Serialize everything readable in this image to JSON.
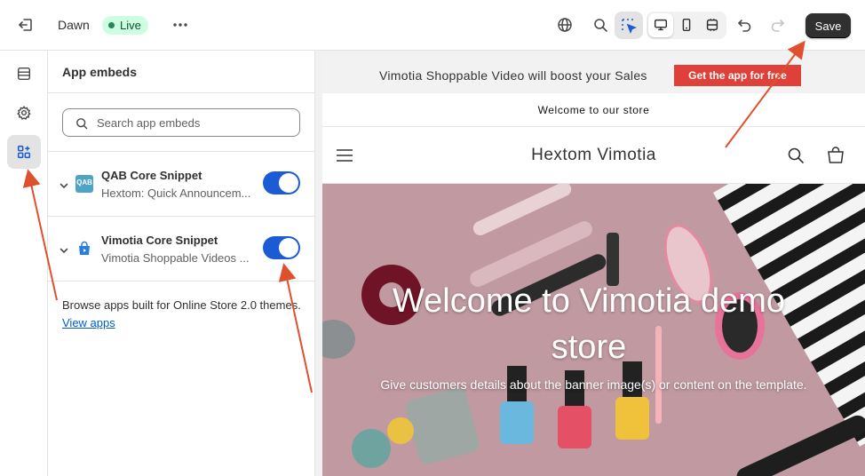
{
  "topbar": {
    "theme_name": "Dawn",
    "status_badge": "Live",
    "save_label": "Save"
  },
  "panel": {
    "title": "App embeds",
    "search_placeholder": "Search app embeds",
    "embeds": [
      {
        "name": "QAB Core Snippet",
        "description": "Hextom: Quick Announcem...",
        "logo_text": "QAB",
        "enabled": true
      },
      {
        "name": "Vimotia Core Snippet",
        "description": "Vimotia Shoppable Videos ...",
        "enabled": true
      }
    ],
    "browse_text": "Browse apps built for Online Store 2.0 themes.",
    "view_apps_link": "View apps"
  },
  "preview": {
    "promo_text": "Vimotia Shoppable Video will boost your Sales",
    "promo_button": "Get the app for free",
    "announcement": "Welcome to our store",
    "store_name": "Hextom Vimotia",
    "hero_title": "Welcome to Vimotia demo store",
    "hero_subtitle": "Give customers details about the banner image(s) or content on the template."
  },
  "colors": {
    "accent": "#1c5bd4",
    "live_badge_bg": "#cdfee1",
    "save_bg": "#303030",
    "promo_button_bg": "#e0403a",
    "annotation_arrow": "#e0502e"
  }
}
